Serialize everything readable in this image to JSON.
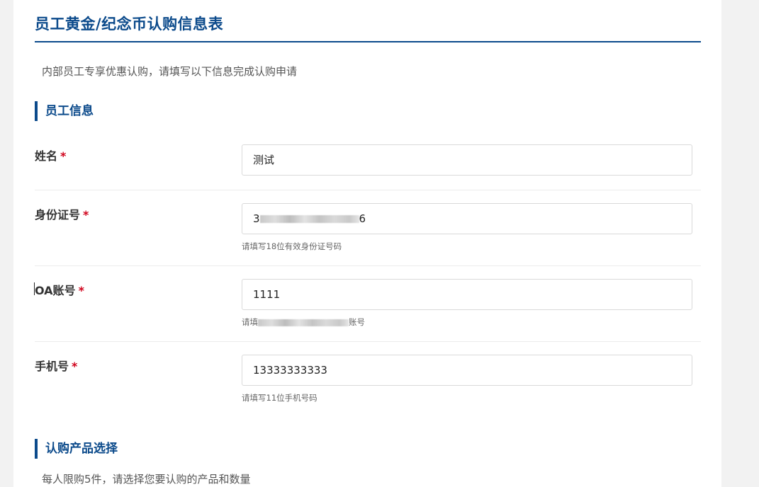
{
  "page": {
    "title": "员工黄金/纪念币认购信息表",
    "subtitle": "内部员工专享优惠认购，请填写以下信息完成认购申请"
  },
  "section_employee": {
    "title": "员工信息"
  },
  "fields": {
    "name": {
      "label": "姓名",
      "required_mark": "*",
      "value": "测试"
    },
    "id_card": {
      "label": "身份证号",
      "required_mark": "*",
      "value_prefix": "3",
      "value_suffix": "6",
      "hint": "请填写18位有效身份证号码"
    },
    "oa": {
      "label": "OA账号",
      "required_mark": "*",
      "value": "1111",
      "hint_prefix": "请填",
      "hint_suffix": "账号"
    },
    "phone": {
      "label": "手机号",
      "required_mark": "*",
      "value": "13333333333",
      "hint": "请填写11位手机号码"
    }
  },
  "section_product": {
    "title": "认购产品选择",
    "note": "每人限购5件，请选择您要认购的产品和数量"
  },
  "colors": {
    "brand": "#0b4a8b",
    "required": "#d0021b",
    "page_bg": "#f2f2f2"
  }
}
